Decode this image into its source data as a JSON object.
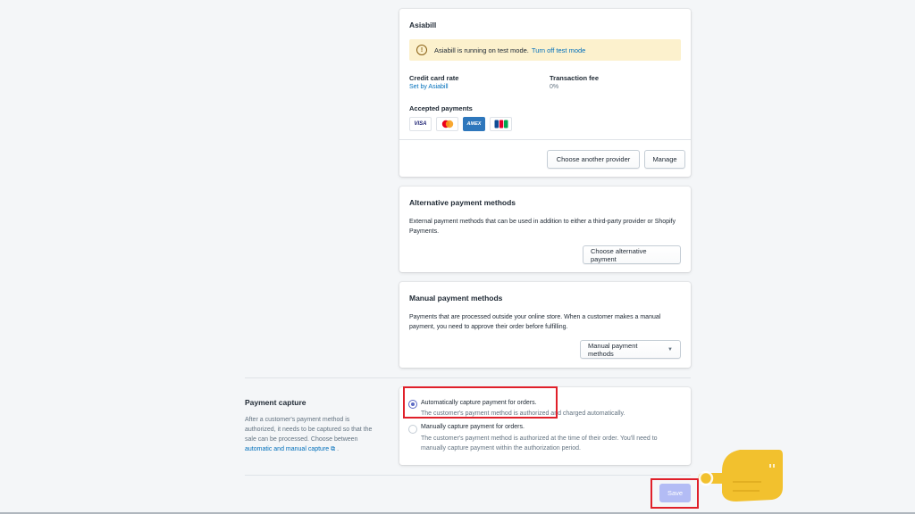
{
  "asiabill": {
    "title": "Asiabill",
    "banner_text": "Asiabill is running on test mode.",
    "banner_link": "Turn off test mode",
    "credit_rate_label": "Credit card rate",
    "credit_rate_value": "Set by Asiabill",
    "transaction_fee_label": "Transaction fee",
    "transaction_fee_value": "0%",
    "accepted_payments_label": "Accepted payments",
    "payment_icons": [
      "visa-icon",
      "mastercard-icon",
      "amex-icon",
      "jcb-icon"
    ],
    "visa_text": "VISA",
    "amex_text": "AMEX",
    "jcb_text": "JCB",
    "choose_provider_label": "Choose another provider",
    "manage_label": "Manage"
  },
  "alternative": {
    "title": "Alternative payment methods",
    "description": "External payment methods that can be used in addition to either a third-party provider or Shopify Payments.",
    "button_label": "Choose alternative payment"
  },
  "manual": {
    "title": "Manual payment methods",
    "description": "Payments that are processed outside your online store. When a customer makes a manual payment, you need to approve their order before fulfilling.",
    "dropdown_label": "Manual payment methods"
  },
  "capture": {
    "title": "Payment capture",
    "description": "After a customer's payment method is authorized, it needs to be captured so that the sale can be processed. Choose between",
    "link_text": "automatic and manual capture",
    "description_end": ".",
    "options": [
      {
        "label": "Automatically capture payment for orders.",
        "help": "The customer's payment method is authorized and charged automatically.",
        "checked": true
      },
      {
        "label": "Manually capture payment for orders.",
        "help": "The customer's payment method is authorized at the time of their order. You'll need to manually capture payment within the authorization period.",
        "checked": false
      }
    ]
  },
  "footer": {
    "save_label": "Save"
  },
  "colors": {
    "accent": "#5c6ac4",
    "link": "#006fbb",
    "banner_bg": "#fcf1cd",
    "highlight_red": "#e0202a",
    "hand_yellow": "#f2c12e"
  }
}
